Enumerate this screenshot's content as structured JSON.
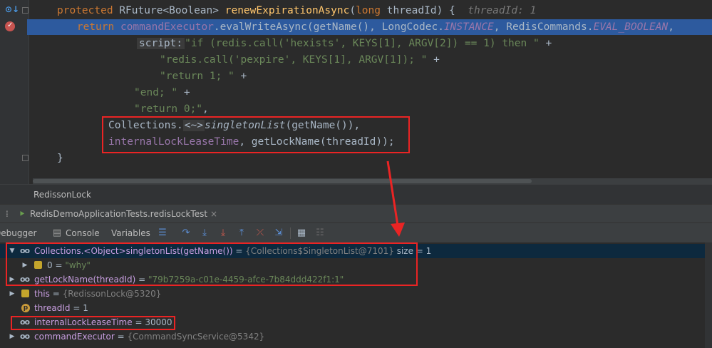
{
  "editor": {
    "line1": {
      "modifier": "protected",
      "type": "RFuture<Boolean>",
      "method": "renewExpirationAsync",
      "paren_open": "(",
      "param_type": "long",
      "param_name": "threadId) {",
      "hint": "threadId: 1"
    },
    "line2": {
      "keyword": "return",
      "field": "commandExecutor",
      "rest1": ".evalWriteAsync(getName(), LongCodec.",
      "instance": "INSTANCE",
      "rest2": ", RedisCommands.",
      "evalbool": "EVAL_BOOLEAN",
      "tail": ","
    },
    "line3": {
      "tag": "script:",
      "text": "\"if (redis.call('hexists', KEYS[1], ARGV[2]) == 1) then \"",
      "op": " +"
    },
    "line4": {
      "text": "\"redis.call('pexpire', KEYS[1], ARGV[1]); \"",
      "op": " +"
    },
    "line5": {
      "text": "\"return 1; \"",
      "op": " +"
    },
    "line6": {
      "text": "\"end; \"",
      "op": " +"
    },
    "line7": {
      "text": "\"return 0;\"",
      "op": ","
    },
    "line8": {
      "prefix": "Collections.",
      "chip": "<~>",
      "method": "singletonList",
      "rest": "(getName()),"
    },
    "line9": {
      "field": "internalLockLeaseTime",
      "rest": ", getLockName(threadId));"
    },
    "line10": {
      "text": "}"
    }
  },
  "breadcrumb": {
    "label": "RedissonLock"
  },
  "run_tab": {
    "label": "RedisDemoApplicationTests.redisLockTest",
    "close": "×"
  },
  "toolbar": {
    "debugger_label": "Debugger",
    "console_label": "Console",
    "variables_label": "Variables"
  },
  "variables": [
    {
      "name": "Collections.<Object>singletonList(getName())",
      "eq": " = ",
      "value": "{Collections$SingletonList@7101}",
      "extra": "  size = 1"
    },
    {
      "name": "0",
      "eq": " = ",
      "value": "\"why\""
    },
    {
      "name": "getLockName(threadId)",
      "eq": " = ",
      "value": "\"79b7259a-c01e-4459-afce-7b84ddd422f1:1\""
    },
    {
      "name": "this",
      "eq": " = ",
      "value": "{RedissonLock@5320}"
    },
    {
      "name": "threadId",
      "eq": " = ",
      "value": "1"
    },
    {
      "name": "internalLockLeaseTime",
      "eq": " = ",
      "value": "30000"
    },
    {
      "name": "commandExecutor",
      "eq": " = ",
      "value": "{CommandSyncService@5342}"
    }
  ],
  "colors": {
    "annotation": "#ea2424",
    "selection": "#2d5a9e"
  }
}
